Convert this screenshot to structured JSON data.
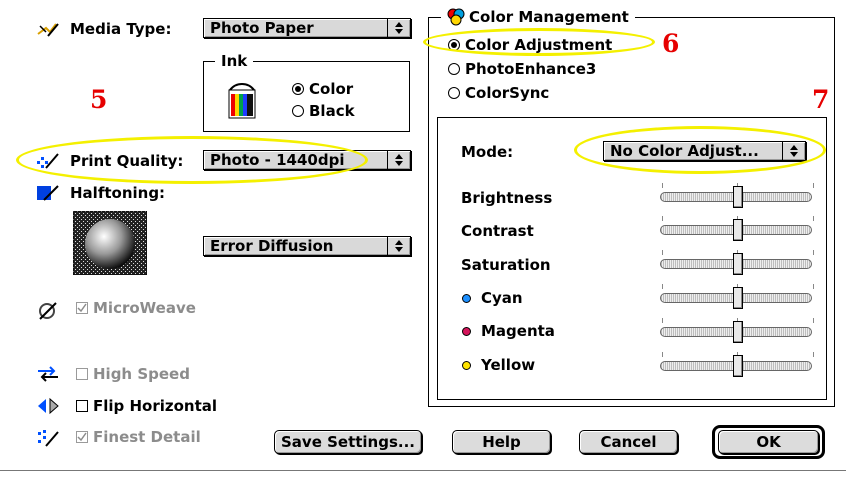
{
  "media_type": {
    "label": "Media Type:",
    "value": "Photo Paper"
  },
  "ink": {
    "title": "Ink",
    "options": [
      "Color",
      "Black"
    ],
    "selected": "Color"
  },
  "print_quality": {
    "label": "Print Quality:",
    "value": "Photo - 1440dpi"
  },
  "halftoning": {
    "label": "Halftoning:",
    "value": "Error Diffusion"
  },
  "checkboxes": {
    "microweave": {
      "label": "MicroWeave",
      "checked": true,
      "enabled": false
    },
    "high_speed": {
      "label": "High Speed",
      "checked": false,
      "enabled": false
    },
    "flip_horizontal": {
      "label": "Flip Horizontal",
      "checked": false,
      "enabled": true
    },
    "finest_detail": {
      "label": "Finest Detail",
      "checked": true,
      "enabled": false
    }
  },
  "color_management": {
    "title": "Color Management",
    "options": [
      "Color Adjustment",
      "PhotoEnhance3",
      "ColorSync"
    ],
    "selected": "Color Adjustment",
    "mode_label": "Mode:",
    "mode_value": "No Color Adjust...",
    "sliders": [
      {
        "label": "Brightness",
        "value": 0
      },
      {
        "label": "Contrast",
        "value": 0
      },
      {
        "label": "Saturation",
        "value": 0
      },
      {
        "label": "Cyan",
        "value": 0,
        "dot_color": "#1e90ff"
      },
      {
        "label": "Magenta",
        "value": 0,
        "dot_color": "#d4145a"
      },
      {
        "label": "Yellow",
        "value": 0,
        "dot_color": "#ffe400"
      }
    ]
  },
  "buttons": {
    "save": "Save Settings...",
    "help": "Help",
    "cancel": "Cancel",
    "ok": "OK"
  },
  "annotations": {
    "a5": "5",
    "a6": "6",
    "a7": "7"
  },
  "colors": {
    "highlight": "#f4f000",
    "annotation": "#e60000"
  }
}
